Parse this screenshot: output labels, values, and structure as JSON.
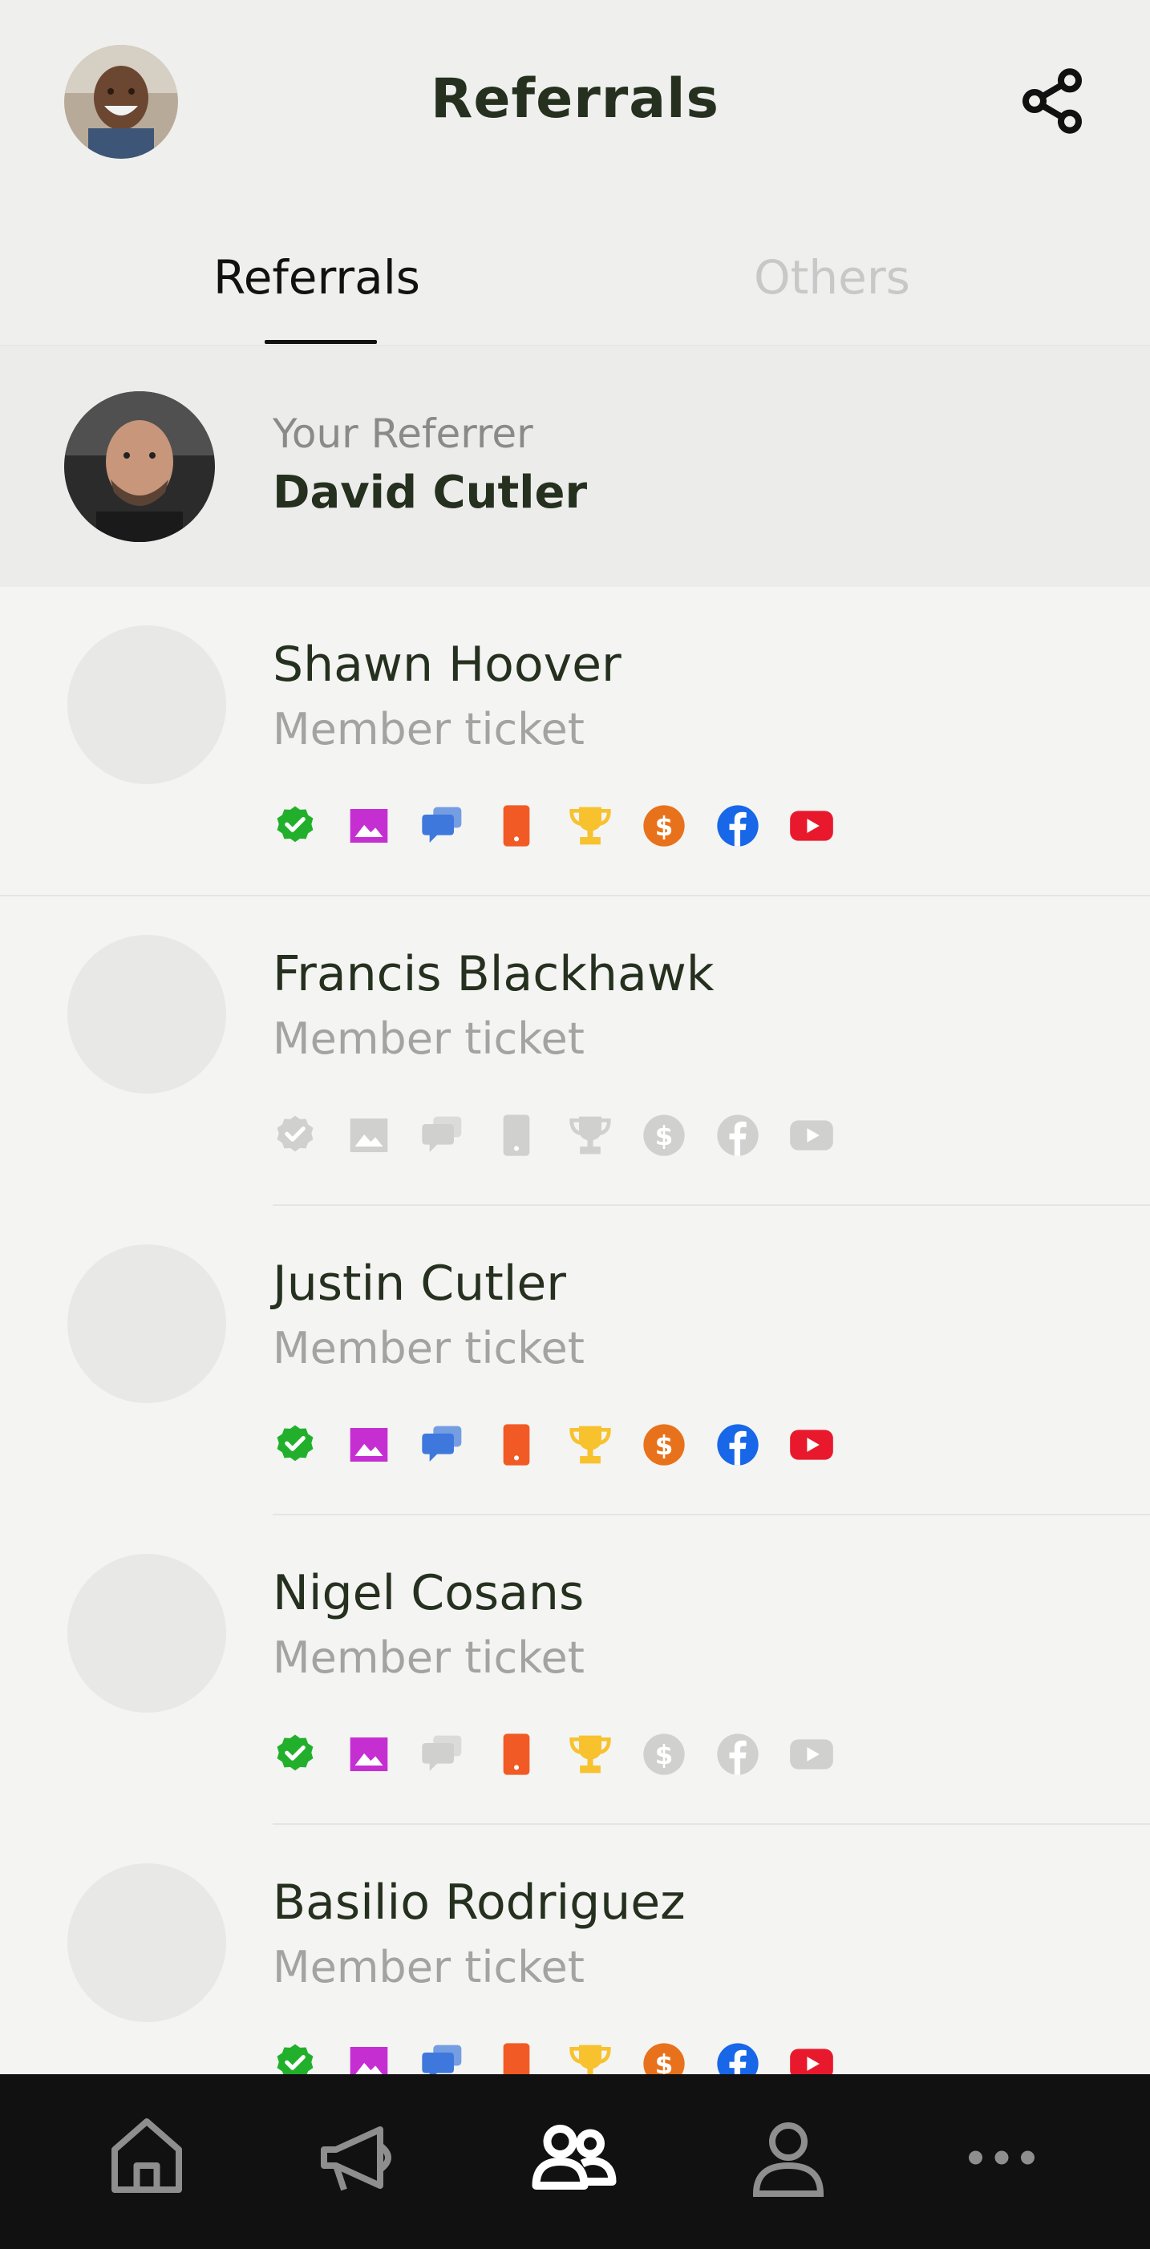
{
  "header": {
    "title": "Referrals"
  },
  "tabs": [
    {
      "label": "Referrals",
      "active": true
    },
    {
      "label": "Others",
      "active": false
    }
  ],
  "referrer": {
    "label": "Your Referrer",
    "name": "David Cutler"
  },
  "referrals": [
    {
      "name": "Shawn Hoover",
      "subtitle": "Member ticket",
      "badges": [
        true,
        true,
        true,
        true,
        true,
        true,
        true,
        true
      ]
    },
    {
      "name": "Francis Blackhawk",
      "subtitle": "Member ticket",
      "badges": [
        false,
        false,
        false,
        false,
        false,
        false,
        false,
        false
      ]
    },
    {
      "name": "Justin Cutler",
      "subtitle": "Member ticket",
      "badges": [
        true,
        true,
        true,
        true,
        true,
        true,
        true,
        true
      ]
    },
    {
      "name": "Nigel Cosans",
      "subtitle": "Member ticket",
      "badges": [
        true,
        true,
        false,
        true,
        true,
        false,
        false,
        false
      ]
    },
    {
      "name": "Basilio Rodriguez",
      "subtitle": "Member ticket",
      "badges": [
        true,
        true,
        true,
        true,
        true,
        true,
        true,
        true
      ]
    }
  ],
  "badge_icons": [
    "verified-icon",
    "photo-icon",
    "chat-icon",
    "phone-icon",
    "trophy-icon",
    "dollar-icon",
    "facebook-icon",
    "youtube-icon"
  ],
  "badge_colors": [
    "#22b02c",
    "#c52fd2",
    "#3e78dc",
    "#f15a24",
    "#f7c22e",
    "#e8721c",
    "#1767e8",
    "#e8192c"
  ],
  "inactive_color": "#d0d0ce",
  "nav": [
    "home-icon",
    "megaphone-icon",
    "referrals-icon",
    "profile-icon",
    "more-icon"
  ]
}
